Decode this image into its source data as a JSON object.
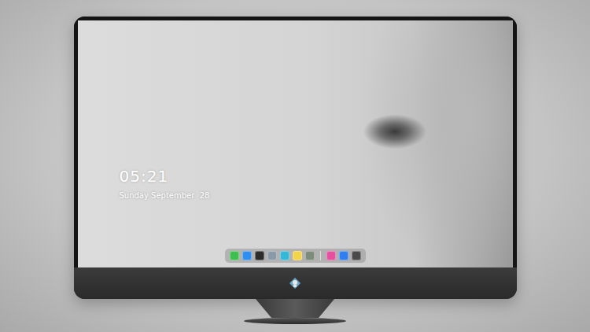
{
  "clock": {
    "time": "05:21",
    "date": "Sunday September  28"
  },
  "dock": {
    "groups": [
      [
        {
          "color": "#3fbf4f"
        },
        {
          "color": "#2f8ff0"
        },
        {
          "color": "#2b2b2b"
        },
        {
          "color": "#8a9aa8"
        },
        {
          "color": "#35b8d8"
        },
        {
          "color": "#f2d44a"
        },
        {
          "color": "#7d8c7a"
        }
      ],
      [
        {
          "color": "#e64fa0"
        },
        {
          "color": "#2f7ff0"
        },
        {
          "color": "#4a4a4a"
        }
      ]
    ]
  }
}
